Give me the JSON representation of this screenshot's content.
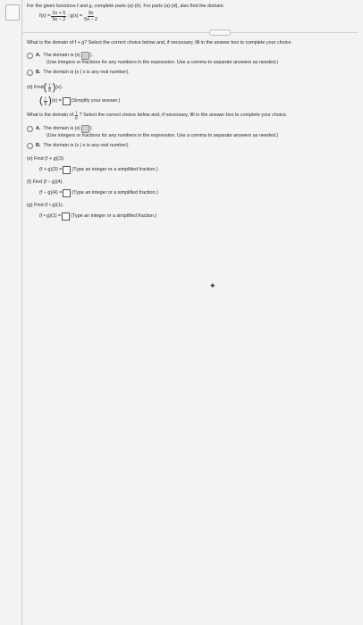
{
  "intro": "For the given functions f and g, complete parts (a)-(h). For parts (a)-(d), also find the domain.",
  "functions": {
    "f_label": "f(x) =",
    "f_num": "2x + 5",
    "f_den": "5x − 2",
    "g_label": "; g(x) =",
    "g_num": "9x",
    "g_den": "5x − 2"
  },
  "question_fg": "What is the domain of f + g? Select the correct choice below and, if necessary, fill in the answer box to complete your choice.",
  "q1": {
    "a_letter": "A.",
    "a_text": "The domain is {x|",
    "a_close": "}.",
    "a_hint": "(Use integers or fractions for any numbers in the expression. Use a comma to separate answers as needed.)",
    "b_letter": "B.",
    "b_text": "The domain is {x | x is any real number}."
  },
  "part_d": {
    "label": "(d) Find",
    "f": "f",
    "g": "g",
    "arg": "(x).",
    "lhs_arg": "(x) =",
    "hint": "(Simplify your answer.)"
  },
  "question_fog": {
    "prefix": "What is the domain of",
    "f": "f",
    "g": "g",
    "suffix": "? Select the correct choice below and, if necessary, fill in the answer box to complete your choice."
  },
  "q2": {
    "a_letter": "A.",
    "a_text": "The domain is {x|",
    "a_close": "}.",
    "a_hint": "(Use integers or fractions for any numbers in the expression. Use a comma to separate answers as needed.)",
    "b_letter": "B.",
    "b_text": "The domain is {x | x is any real number}."
  },
  "part_e": {
    "label": "(e) Find (f + g)(3).",
    "lhs": "(f + g)(3) =",
    "hint": "(Type an integer or a simplified fraction.)"
  },
  "part_f": {
    "label": "(f) Find (f − g)(4).",
    "lhs": "(f − g)(4) =",
    "hint": "(Type an integer or a simplified fraction.)"
  },
  "part_g": {
    "label": "(g) Find (f • g)(1).",
    "lhs": "(f • g)(1) =",
    "hint": "(Type an integer or a simplified fraction.)"
  }
}
